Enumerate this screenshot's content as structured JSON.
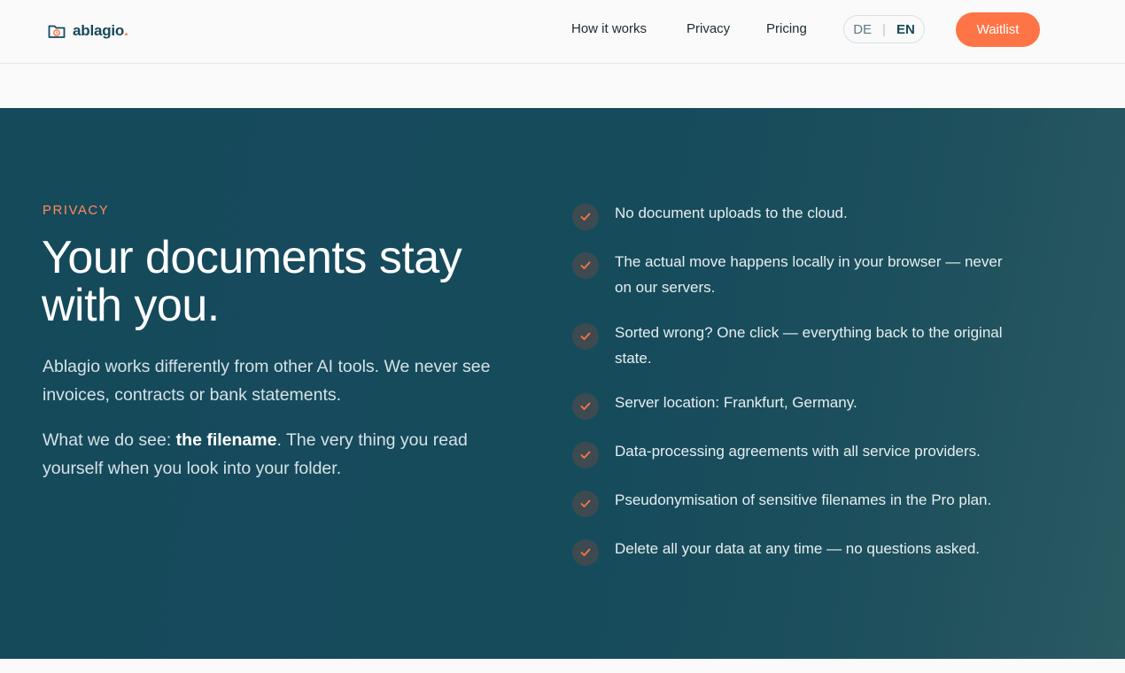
{
  "header": {
    "logo_text": "ablagio",
    "logo_dot": ".",
    "nav": [
      "How it works",
      "Privacy",
      "Pricing"
    ],
    "lang": {
      "de": "DE",
      "separator": "|",
      "en": "EN"
    },
    "waitlist_label": "Waitlist"
  },
  "hero": {
    "eyebrow": "PRIVACY",
    "headline": "Your documents stay with you.",
    "para1": "Ablagio works differently from other AI tools. We never see invoices, contracts or bank statements.",
    "para2_prefix": "What we do see: ",
    "para2_bold": "the filename",
    "para2_suffix": ". The very thing you read yourself when you look into your folder.",
    "points": [
      "No document uploads to the cloud.",
      "The actual move happens locally in your browser — never on our servers.",
      "Sorted wrong? One click — everything back to the original state.",
      "Server location: Frankfurt, Germany.",
      "Data-processing agreements with all service providers.",
      "Pseudonymisation of sensitive filenames in the Pro plan.",
      "Delete all your data at any time — no questions asked."
    ]
  },
  "colors": {
    "brand": "#17495a",
    "accent": "#ff7447",
    "hero_bg": "#164b5c"
  },
  "icons": {
    "logo": "folder-clock-icon",
    "check": "check-icon"
  }
}
